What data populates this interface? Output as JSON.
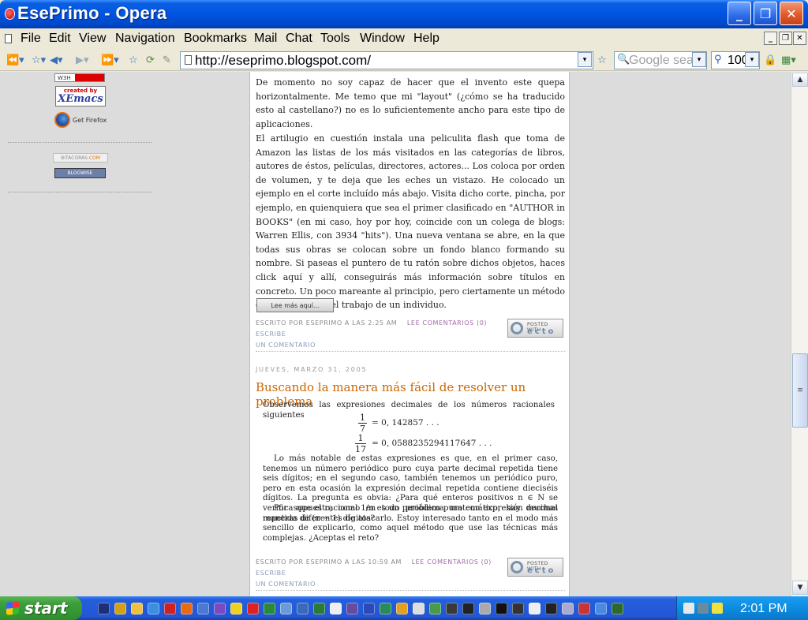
{
  "window": {
    "title": "EsePrimo - Opera",
    "controls": {
      "minimize": "_",
      "maximize": "❐",
      "close": "✕"
    }
  },
  "menubar": {
    "items": [
      "File",
      "Edit",
      "View",
      "Navigation",
      "Bookmarks",
      "Mail",
      "Chat",
      "Tools",
      "Window",
      "Help"
    ]
  },
  "toolbar": {
    "address": "http://eseprimo.blogspot.com/",
    "search_placeholder": "Google sea",
    "zoom": "100"
  },
  "sidebar": {
    "badges": {
      "w3h": "W3H",
      "xemacs_top": "created by",
      "xemacs_main": "XEmacs",
      "firefox": "Get Firefox",
      "bitacoras_a": "BITACORAS",
      "bitacoras_b": ".COM",
      "bloguise": "BLOGWISE"
    }
  },
  "post1": {
    "para1": "De momento no soy capaz de hacer que el invento este quepa horizontalmente. Me temo que mi \"layout\" (¿cómo se ha traducido esto al castellano?) no es lo suficientemente ancho para este tipo de aplicaciones.",
    "para2": "El artilugio en cuestión instala una peliculita flash que toma de Amazon las listas de los más visitados en las categorías de libros, autores de éstos, películas, directores, actores... Los coloca por orden de volumen, y te deja que les eches un vistazo. He colocado un ejemplo en el corte incluído más abajo. Visita dicho corte, pincha, por ejemplo, en quienquiera que sea el primer clasificado en \"AUTHOR in BOOKS\" (en mi caso, hoy por hoy, coincide con un colega de blogs: Warren Ellis, con 3934 \"hits\"). Una nueva ventana se abre, en la que todas sus obras se colocan sobre un fondo blanco formando su nombre. Si paseas el puntero de tu ratón sobre dichos objetos, haces click aquí y allí, conseguirás más información sobre títulos en concreto. Un poco mareante al principio, pero ciertamente un método eficaz de revisar el trabajo de un individuo.",
    "read_more": "Lee más aquí...",
    "meta_prefix": "ESCRITO POR ESEPRIMO A LAS 2:25 AM",
    "comments": "LEE COMENTARIOS (0)",
    "write_a": "ESCRIBE",
    "write_b": "UN COMENTARIO",
    "ecto_top": "POSTED WITH",
    "ecto_main": "ecto"
  },
  "post2": {
    "date": "JUEVES, MARZO 31, 2005",
    "title": "Buscando la manera más fácil de resolver un problema",
    "math": {
      "intro": "Observemos las expresiones decimales de los números racionales siguientes",
      "frac1_num": "1",
      "frac1_den": "7",
      "eq1": "= 0, 142857 . . .",
      "frac2_num": "1",
      "frac2_den": "17",
      "eq2": "= 0, 0588235294117647 . . .",
      "p1": "Lo más notable de estas expresiones es que, en el primer caso, tenemos un número periódico puro cuya parte decimal repetida tiene seis dígitos; en el segundo caso, también tenemos un periódico puro, pero en esta ocasión la expresión decimal repetida contiene dieciséis dígitos. La pregunta es obvia: ¿Para qué enteros positivos n ∈ N se verifica que el racional 1/n es un periódico puro con expresión decimal repetida de (n − 1) dígitos?",
      "p2": "Por supuesto, como en todo problema matemático, hay muchas maneras diferentes de atacarlo. Estoy interesado tanto en el modo más sencillo de explicarlo, como aquel método que use las técnicas más complejas. ¿Aceptas el reto?"
    },
    "meta_prefix": "ESCRITO POR ESEPRIMO A LAS 10:59 AM",
    "comments": "LEE COMENTARIOS (0)",
    "write_a": "ESCRIBE",
    "write_b": "UN COMENTARIO",
    "ecto_top": "POSTED WITH",
    "ecto_main": "ecto"
  },
  "taskbar": {
    "start": "start",
    "clock": "2:01 PM"
  },
  "colors": {
    "title_blue": "#0054e3",
    "post_title": "#cc6600",
    "meta_link": "#a06aa6",
    "start_green": "#3c9f3a"
  }
}
